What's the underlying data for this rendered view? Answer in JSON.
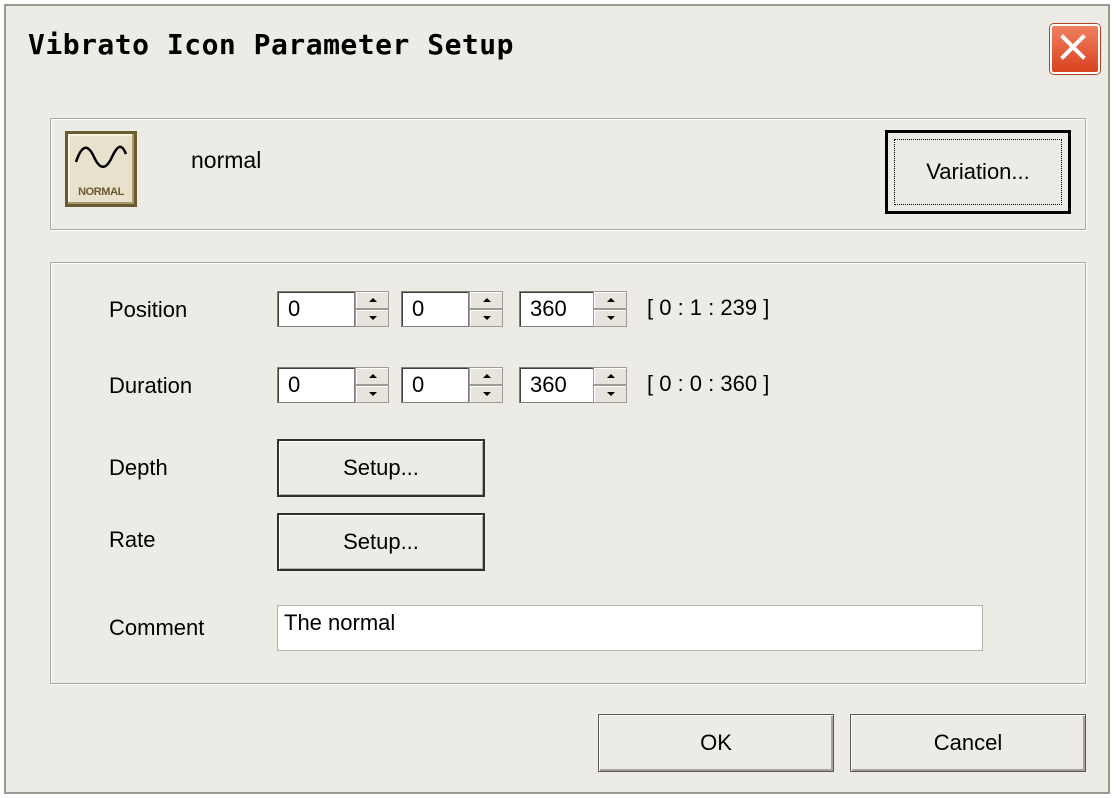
{
  "window": {
    "title": "Vibrato Icon Parameter Setup"
  },
  "header": {
    "icon_label": "NORMAL",
    "name": "normal",
    "variation_label": "Variation..."
  },
  "params": {
    "position": {
      "label": "Position",
      "values": [
        "0",
        "0",
        "360"
      ],
      "readout": "[ 0 : 1 : 239 ]"
    },
    "duration": {
      "label": "Duration",
      "values": [
        "0",
        "0",
        "360"
      ],
      "readout": "[ 0 : 0 : 360 ]"
    },
    "depth": {
      "label": "Depth",
      "button_label": "Setup..."
    },
    "rate": {
      "label": "Rate",
      "button_label": "Setup..."
    },
    "comment": {
      "label": "Comment",
      "value": "The normal"
    }
  },
  "buttons": {
    "ok": "OK",
    "cancel": "Cancel"
  },
  "icons": {
    "close": "close-icon",
    "vibrato": "vibrato-wave-icon"
  },
  "colors": {
    "dialog_bg": "#ecebe6",
    "close_button": "#d9421f"
  }
}
